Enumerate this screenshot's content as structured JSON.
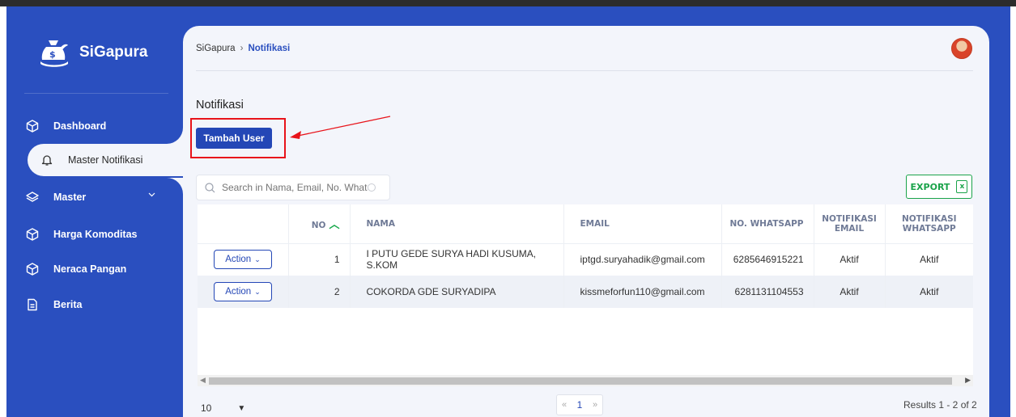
{
  "app": {
    "name": "SiGapura"
  },
  "sidebar": {
    "items": [
      {
        "label": "Dashboard"
      },
      {
        "label": "Master Notifikasi"
      },
      {
        "label": "Master"
      },
      {
        "label": "Harga Komoditas"
      },
      {
        "label": "Neraca Pangan"
      },
      {
        "label": "Berita"
      }
    ]
  },
  "breadcrumb": {
    "root": "SiGapura",
    "current": "Notifikasi"
  },
  "page": {
    "title": "Notifikasi",
    "add_button": "Tambah User"
  },
  "search": {
    "placeholder": "Search in Nama, Email, No. Whatsapp"
  },
  "export": {
    "label": "EXPORT"
  },
  "table": {
    "headers": {
      "no": "NO",
      "nama": "NAMA",
      "email": "EMAIL",
      "wa": "NO. WHATSAPP",
      "notif_email": "NOTIFIKASI EMAIL",
      "notif_wa": "NOTIFIKASI WHATSAPP"
    },
    "action_label": "Action",
    "rows": [
      {
        "no": "1",
        "nama": "I PUTU GEDE SURYA HADI KUSUMA, S.KOM",
        "email": "iptgd.suryahadik@gmail.com",
        "wa": "6285646915221",
        "notif_email": "Aktif",
        "notif_wa": "Aktif"
      },
      {
        "no": "2",
        "nama": "COKORDA GDE SURYADIPA",
        "email": "kissmeforfun110@gmail.com",
        "wa": "6281131104553",
        "notif_email": "Aktif",
        "notif_wa": "Aktif"
      }
    ]
  },
  "pagination": {
    "page_size": "10",
    "prev": "«",
    "current_page": "1",
    "next": "»",
    "results": "Results 1 - 2 of 2"
  },
  "colors": {
    "sidebar": "#2a4fbf",
    "primary": "#2447b6",
    "content_bg": "#f3f5fb",
    "export_green": "#1aa34a",
    "highlight_red": "#e8131a"
  }
}
